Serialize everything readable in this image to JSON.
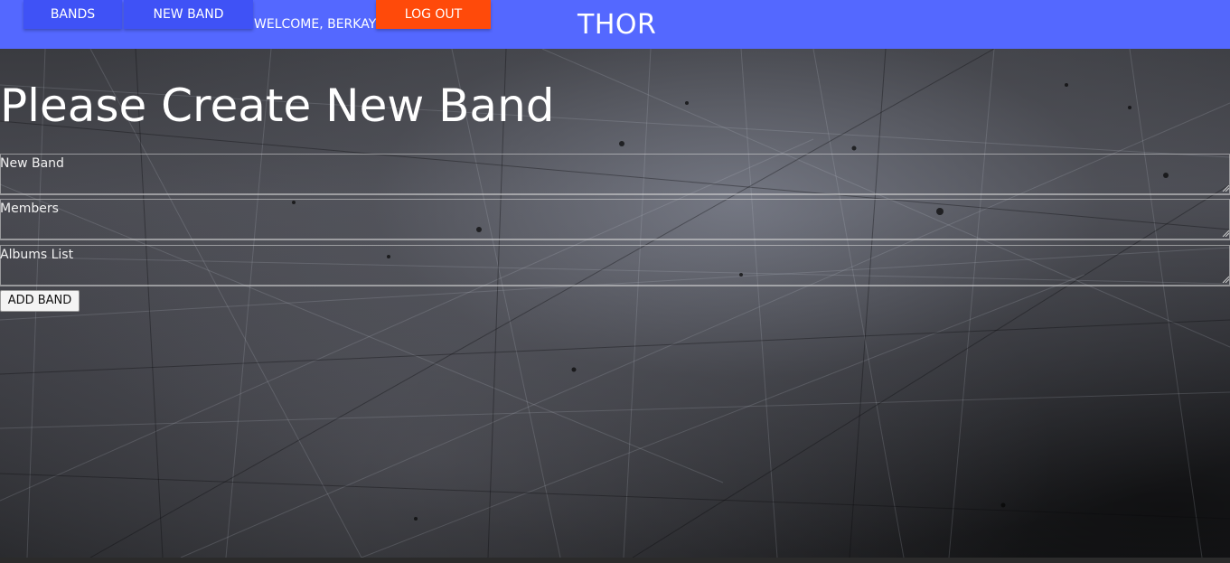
{
  "navbar": {
    "bands_label": "BANDS",
    "new_band_label": "NEW BAND",
    "welcome_text": "WELCOME, BERKAY",
    "logout_label": "LOG OUT",
    "brand": "THOR"
  },
  "form": {
    "heading": "Please Create New Band",
    "fields": [
      {
        "label": "New Band",
        "value": ""
      },
      {
        "label": "Members",
        "value": ""
      },
      {
        "label": "Albums List",
        "value": ""
      }
    ],
    "submit_label": "ADD BAND"
  },
  "colors": {
    "navbar": "#5468ff",
    "nav_button": "#3f52f6",
    "logout_button": "#ff4a0a",
    "text": "#ffffff"
  }
}
